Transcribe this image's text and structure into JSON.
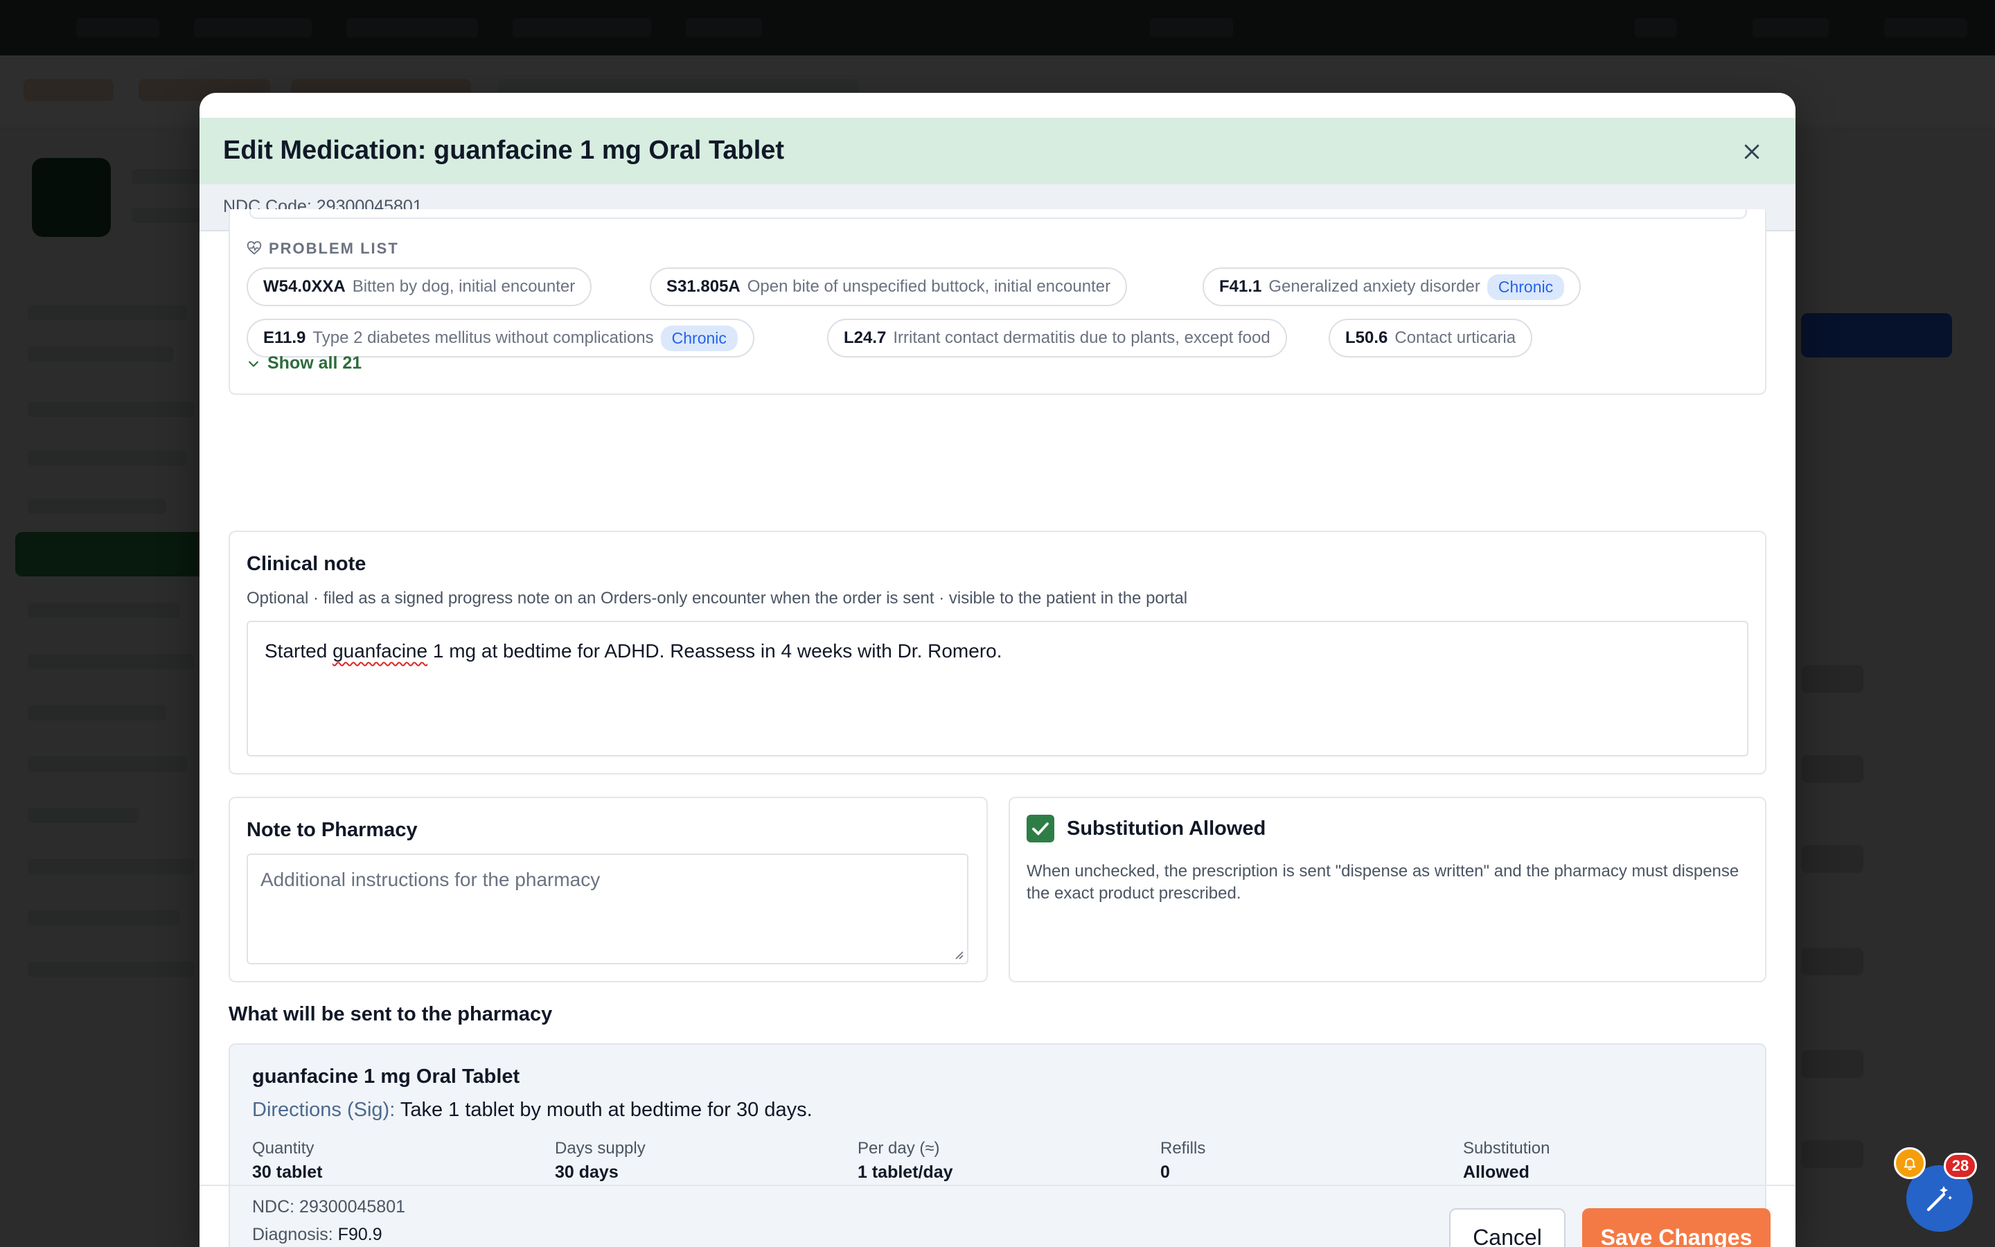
{
  "modal": {
    "title": "Edit Medication: guanfacine 1 mg Oral Tablet",
    "ndc_line": "NDC Code: 29300045801"
  },
  "problem_list": {
    "heading": "PROBLEM LIST",
    "items": [
      {
        "code": "W54.0XXA",
        "desc": "Bitten by dog, initial encounter",
        "badge": ""
      },
      {
        "code": "S31.805A",
        "desc": "Open bite of unspecified buttock, initial encounter",
        "badge": ""
      },
      {
        "code": "F41.1",
        "desc": "Generalized anxiety disorder",
        "badge": "Chronic"
      },
      {
        "code": "E11.9",
        "desc": "Type 2 diabetes mellitus without complications",
        "badge": "Chronic"
      },
      {
        "code": "L24.7",
        "desc": "Irritant contact dermatitis due to plants, except food",
        "badge": ""
      },
      {
        "code": "L50.6",
        "desc": "Contact urticaria",
        "badge": ""
      }
    ],
    "show_all": "Show all 21"
  },
  "clinical_note": {
    "title": "Clinical note",
    "hint": "Optional · filed as a signed progress note on an Orders-only encounter when the order is sent · visible to the patient in the portal",
    "text_before": "Started ",
    "text_misspelled": "guanfacine",
    "text_after": " 1 mg at bedtime for ADHD. Reassess in 4 weeks with Dr. Romero."
  },
  "pharmacy_note": {
    "title": "Note to Pharmacy",
    "placeholder": "Additional instructions for the pharmacy"
  },
  "substitution": {
    "label": "Substitution Allowed",
    "checked": true,
    "hint": "When unchecked, the prescription is sent \"dispense as written\" and the pharmacy must dispense the exact product prescribed."
  },
  "summary": {
    "title": "What will be sent to the pharmacy",
    "drug": "guanfacine 1 mg Oral Tablet",
    "sig_label": "Directions (Sig):",
    "sig_value": " Take 1 tablet by mouth at bedtime for 30 days.",
    "fields": [
      {
        "key": "Quantity",
        "value": "30 tablet"
      },
      {
        "key": "Days supply",
        "value": "30 days"
      },
      {
        "key": "Per day (≈)",
        "value": "1 tablet/day"
      },
      {
        "key": "Refills",
        "value": "0"
      },
      {
        "key": "Substitution",
        "value": "Allowed"
      }
    ],
    "ndc": "NDC: 29300045801",
    "diagnosis_label": "Diagnosis:",
    "diagnosis_value": " F90.9"
  },
  "footer": {
    "cancel": "Cancel",
    "save": "Save Changes"
  },
  "widgets": {
    "notification_count": "28"
  },
  "colors": {
    "header_bg": "#d6ede0",
    "accent_green": "#2e7d46",
    "save_orange": "#f47a45",
    "chronic_blue": "#2563eb"
  },
  "icons": [
    "close-icon",
    "heart-pulse-icon",
    "chevron-down-icon",
    "check-icon",
    "bell-icon",
    "magic-wand-icon"
  ]
}
